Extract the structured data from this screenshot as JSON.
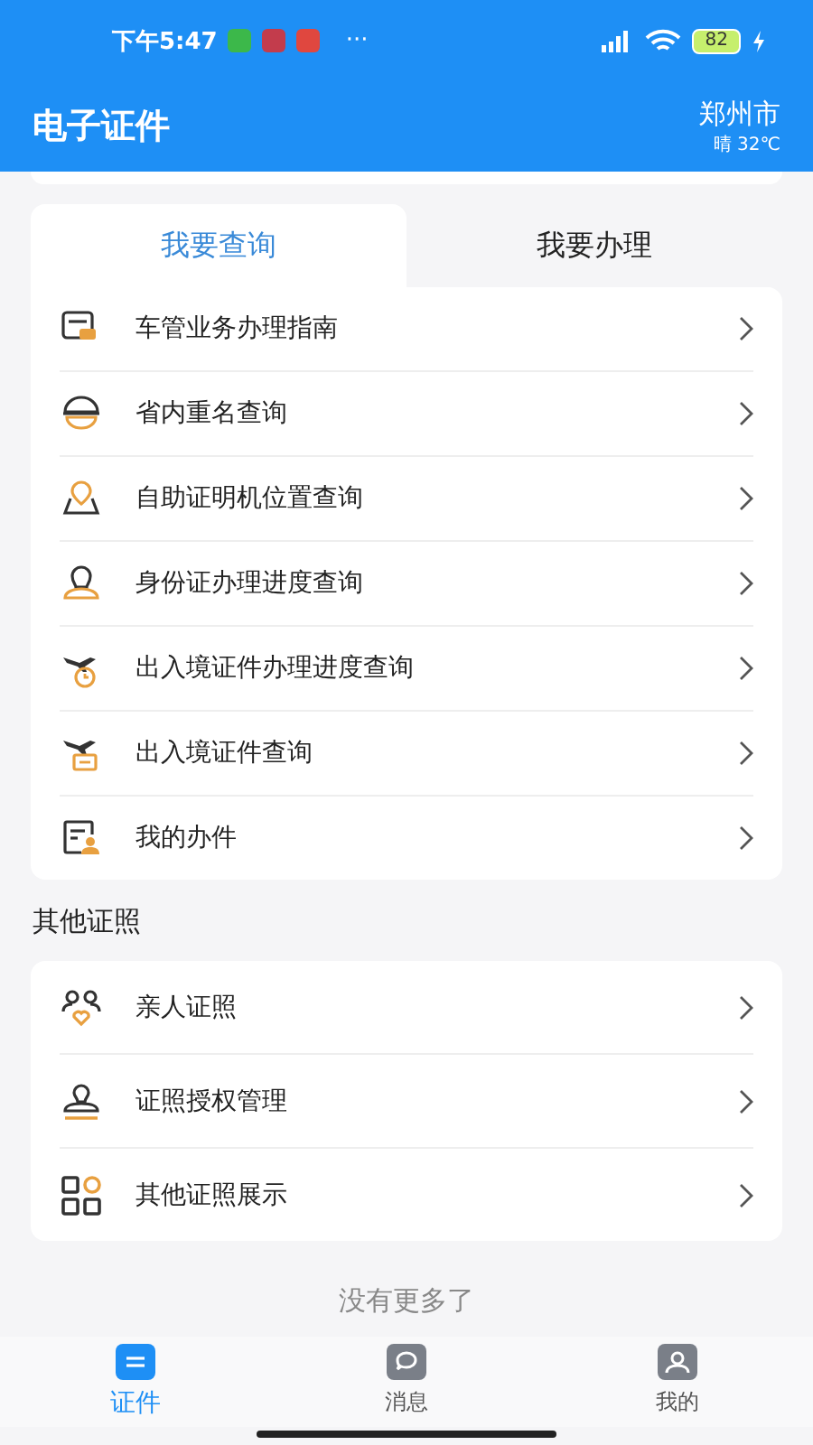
{
  "status_bar": {
    "time": "下午5:47",
    "more": "···",
    "battery": "82"
  },
  "header": {
    "title": "电子证件",
    "city": "郑州市",
    "weather": "晴 32℃"
  },
  "tabs": [
    {
      "label": "我要查询",
      "selected": true
    },
    {
      "label": "我要办理",
      "selected": false
    }
  ],
  "query_items": [
    {
      "label": "车管业务办理指南"
    },
    {
      "label": "省内重名查询"
    },
    {
      "label": "自助证明机位置查询"
    },
    {
      "label": "身份证办理进度查询"
    },
    {
      "label": "出入境证件办理进度查询"
    },
    {
      "label": "出入境证件查询"
    },
    {
      "label": "我的办件"
    }
  ],
  "other_section": {
    "title": "其他证照",
    "items": [
      {
        "label": "亲人证照"
      },
      {
        "label": "证照授权管理"
      },
      {
        "label": "其他证照展示"
      }
    ]
  },
  "footer_note": "没有更多了",
  "bottom_nav": [
    {
      "label": "证件",
      "selected": true
    },
    {
      "label": "消息",
      "selected": false
    },
    {
      "label": "我的",
      "selected": false
    }
  ]
}
